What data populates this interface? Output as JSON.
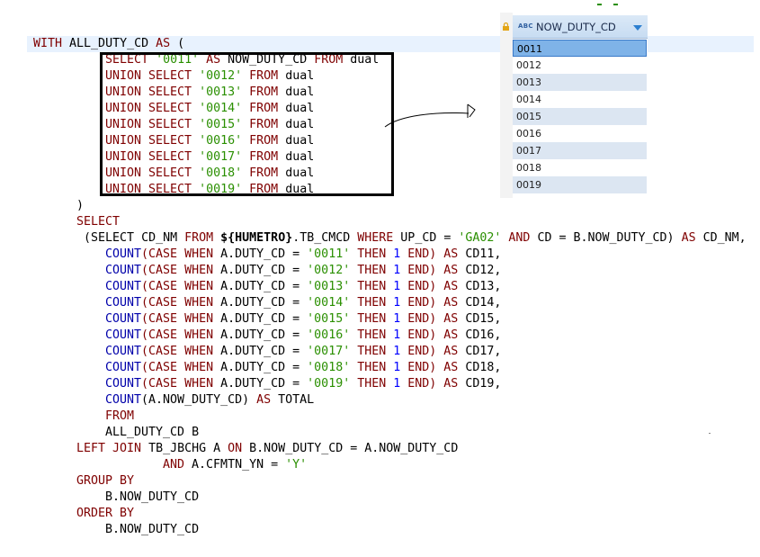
{
  "grid": {
    "column_name": "NOW_DUTY_CD",
    "type_badge": "ABC",
    "rows": [
      "0011",
      "0012",
      "0013",
      "0014",
      "0015",
      "0016",
      "0017",
      "0018",
      "0019"
    ]
  },
  "sql": {
    "with_line": {
      "kw1": "WITH",
      "name": " ALL_DUTY_CD ",
      "kw2": "AS",
      "paren": " ("
    },
    "union_rows": [
      {
        "prefix": "SELECT",
        "code": "'0011'",
        "rest_kw": "AS",
        "alias": " NOW_DUTY_CD ",
        "from": "FROM",
        "tbl": " dual"
      },
      {
        "prefix": "UNION SELECT",
        "code": "'0012'",
        "from": "FROM",
        "tbl": " dual"
      },
      {
        "prefix": "UNION SELECT",
        "code": "'0013'",
        "from": "FROM",
        "tbl": " dual"
      },
      {
        "prefix": "UNION SELECT",
        "code": "'0014'",
        "from": "FROM",
        "tbl": " dual"
      },
      {
        "prefix": "UNION SELECT",
        "code": "'0015'",
        "from": "FROM",
        "tbl": " dual"
      },
      {
        "prefix": "UNION SELECT",
        "code": "'0016'",
        "from": "FROM",
        "tbl": " dual"
      },
      {
        "prefix": "UNION SELECT",
        "code": "'0017'",
        "from": "FROM",
        "tbl": " dual"
      },
      {
        "prefix": "UNION SELECT",
        "code": "'0018'",
        "from": "FROM",
        "tbl": " dual"
      },
      {
        "prefix": "UNION SELECT",
        "code": "'0019'",
        "from": "FROM",
        "tbl": " dual"
      }
    ],
    "close_paren": ")",
    "select_kw": "SELECT",
    "subquery": {
      "open": " (SELECT ",
      "cd_nm": "CD_NM ",
      "from": "FROM",
      "var": " ${HUMETRO}",
      "tbl": ".TB_CMCD ",
      "where": "WHERE",
      "cond": " UP_CD = ",
      "ga": "'GA02'",
      "and": " AND",
      "cond2": " CD = B.NOW_DUTY_CD) ",
      "as": "AS",
      "alias": " CD_NM,"
    },
    "count_rows": [
      {
        "val": "'0011'",
        "alias": " CD11,"
      },
      {
        "val": "'0012'",
        "alias": " CD12,"
      },
      {
        "val": "'0013'",
        "alias": " CD13,"
      },
      {
        "val": "'0014'",
        "alias": " CD14,"
      },
      {
        "val": "'0015'",
        "alias": " CD15,"
      },
      {
        "val": "'0016'",
        "alias": " CD16,"
      },
      {
        "val": "'0017'",
        "alias": " CD17,"
      },
      {
        "val": "'0018'",
        "alias": " CD18,"
      },
      {
        "val": "'0019'",
        "alias": " CD19,"
      }
    ],
    "count_kw": "COUNT",
    "case_kw": "(CASE",
    "when_kw": " WHEN",
    "cond_col": " A.DUTY_CD = ",
    "then_kw": " THEN",
    "one": " 1",
    "end_kw": " END)",
    "as_kw": " AS",
    "total_line": {
      "count": "COUNT",
      "expr": "(A.NOW_DUTY_CD) ",
      "as": "AS",
      "alias": " TOTAL"
    },
    "from_kw": "FROM",
    "from_tbl": "ALL_DUTY_CD B",
    "join_line": {
      "kw": "LEFT JOIN",
      "tbl": " TB_JBCHG A ",
      "on": "ON",
      "cond": " B.NOW_DUTY_CD = A.NOW_DUTY_CD"
    },
    "and_line": {
      "kw": "AND",
      "cond": " A.CFMTN_YN = ",
      "val": "'Y'"
    },
    "group_kw": "GROUP BY",
    "group_col": "B.NOW_DUTY_CD",
    "order_kw": "ORDER BY",
    "order_col": "B.NOW_DUTY_CD"
  }
}
